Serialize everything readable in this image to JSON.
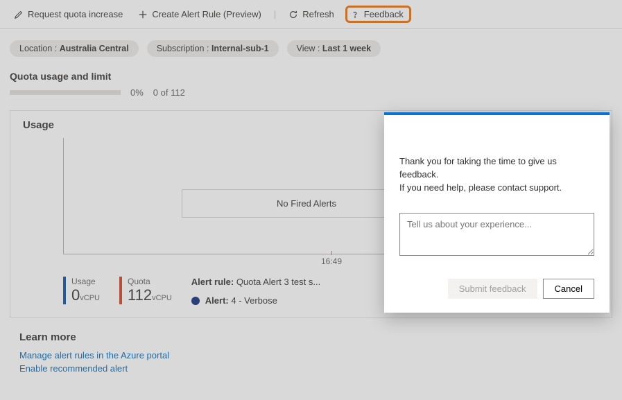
{
  "toolbar": {
    "request_quota": "Request quota increase",
    "create_alert": "Create Alert Rule (Preview)",
    "refresh": "Refresh",
    "feedback": "Feedback"
  },
  "filters": {
    "location_label": "Location : ",
    "location_value": "Australia Central",
    "subscription_label": "Subscription : ",
    "subscription_value": "Internal-sub-1",
    "view_label": "View : ",
    "view_value": "Last 1 week"
  },
  "quota": {
    "heading": "Quota usage and limit",
    "percent": "0%",
    "count_text": "0 of 112"
  },
  "chart": {
    "card_title": "Usage",
    "empty_text": "No Fired Alerts",
    "x_tick": "16:49",
    "legend": {
      "usage_label": "Usage",
      "usage_value": "0",
      "usage_unit": "vCPU",
      "usage_color": "#0b4da2",
      "quota_label": "Quota",
      "quota_value": "112",
      "quota_unit": "vCPU",
      "quota_color": "#d14124"
    },
    "alert_rule_label": "Alert rule:",
    "alert_rule_value": " Quota Alert 3 test s...",
    "alert_label": "Alert:",
    "alert_value": " 4 - Verbose"
  },
  "learn_more": {
    "heading": "Learn more",
    "link1": "Manage alert rules in the Azure portal",
    "link2": "Enable recommended alert"
  },
  "feedback_panel": {
    "line1": "Thank you for taking the time to give us feedback.",
    "line2": "If you need help, please contact support.",
    "placeholder": "Tell us about your experience...",
    "submit": "Submit feedback",
    "cancel": "Cancel"
  }
}
